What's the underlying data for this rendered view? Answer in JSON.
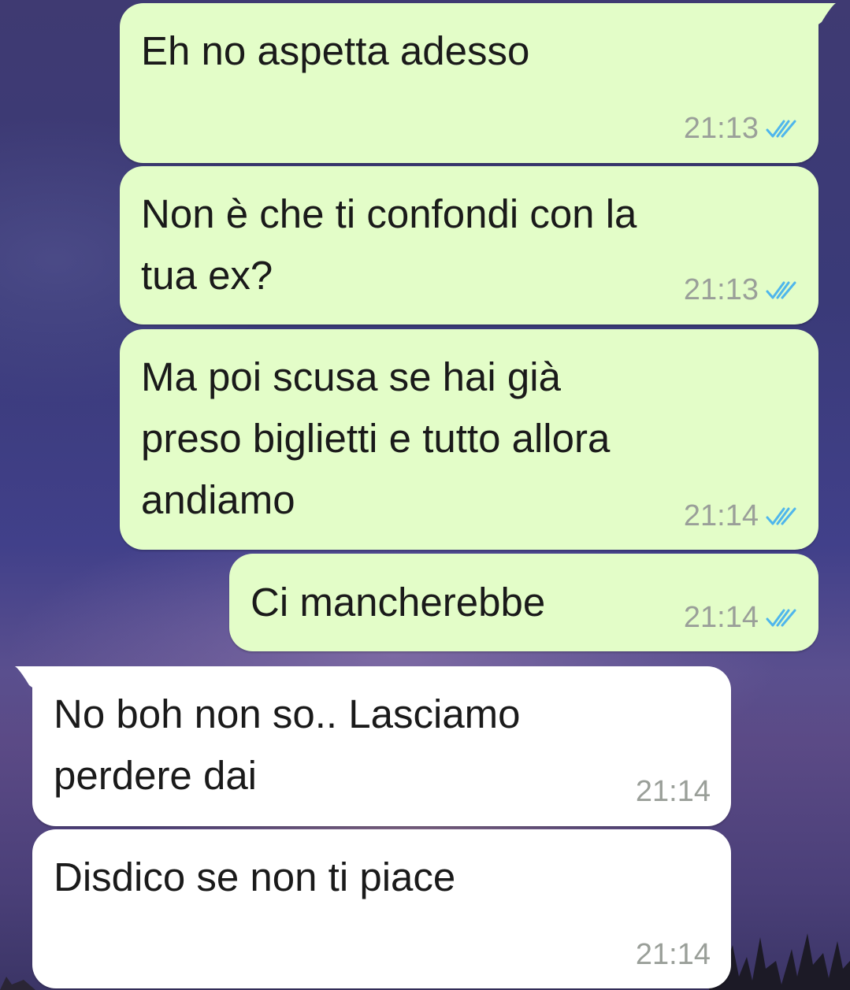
{
  "messages": [
    {
      "text": "Eh no aspetta adesso",
      "time": "21:13",
      "status": "read"
    },
    {
      "text": "Non è che ti confondi con la\ntua ex?",
      "time": "21:13",
      "status": "read"
    },
    {
      "text": "Ma poi scusa se hai già\npreso biglietti e tutto allora\nandiamo",
      "time": "21:14",
      "status": "read"
    },
    {
      "text": "Ci mancherebbe",
      "time": "21:14",
      "status": "read"
    },
    {
      "text": "No boh non so.. Lasciamo\nperdere dai",
      "time": "21:14"
    },
    {
      "text": "Disdico se non ti piace",
      "time": "21:14"
    }
  ],
  "colors": {
    "outgoing_bubble": "#e3fdc8",
    "incoming_bubble": "#ffffff",
    "read_ticks": "#4fb6ec",
    "timestamp": "#9a9f99"
  },
  "icons": {
    "read_receipt": "double-check-icon"
  }
}
